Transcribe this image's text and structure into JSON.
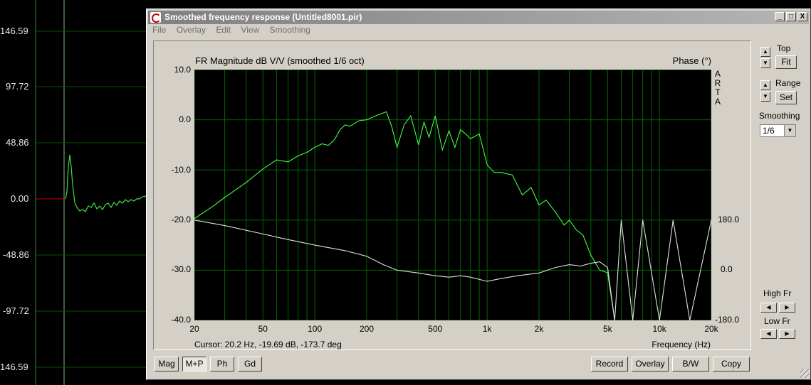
{
  "background_plot": {
    "y_labels": [
      "146.59",
      "97.72",
      "48.86",
      "0.00",
      "-48.86",
      "-97.72",
      "146.59"
    ],
    "colors": {
      "zero_line": "#d00000",
      "grid": "#80d080",
      "trace": "#40e040"
    }
  },
  "window": {
    "title": "Smoothed frequency response (Untitled8001.pir)",
    "controls": {
      "minimize": "_",
      "maximize": "□",
      "close": "X"
    }
  },
  "menu": [
    "File",
    "Overlay",
    "Edit",
    "View",
    "Smoothing"
  ],
  "plot": {
    "title": "FR Magnitude dB V/V (smoothed 1/6 oct)",
    "phase_title": "Phase (°)",
    "brand": [
      "A",
      "R",
      "T",
      "A"
    ],
    "cursor": "Cursor: 20.2 Hz, -19.69 dB, -173.7 deg",
    "x_axis_label": "Frequency (Hz)"
  },
  "chart_data": {
    "type": "line",
    "title": "FR Magnitude dB V/V (smoothed 1/6 oct)",
    "xlabel": "Frequency (Hz)",
    "ylabel": "",
    "y2label": "Phase (°)",
    "x_scale": "log",
    "xlim": [
      20,
      20000
    ],
    "ylim": [
      -40,
      10
    ],
    "y2lim": [
      -180,
      180
    ],
    "x_ticks": [
      "20",
      "50",
      "100",
      "200",
      "500",
      "1k",
      "2k",
      "5k",
      "10k",
      "20k"
    ],
    "y_ticks": [
      "10.0",
      "0.0",
      "-10.0",
      "-20.0",
      "-30.0",
      "-40.0"
    ],
    "y2_ticks": [
      "180.0",
      "0.0",
      "-180.0"
    ],
    "colors": {
      "magnitude": "#40ff40",
      "phase": "#e0e0e0",
      "grid": "#006600",
      "background": "#000000"
    },
    "series": [
      {
        "role": "magnitude",
        "x": [
          20,
          25,
          30,
          40,
          50,
          60,
          70,
          80,
          90,
          100,
          110,
          120,
          130,
          140,
          150,
          160,
          180,
          200,
          230,
          260,
          280,
          300,
          330,
          360,
          400,
          430,
          460,
          500,
          550,
          600,
          650,
          700,
          750,
          800,
          900,
          1000,
          1100,
          1200,
          1400,
          1600,
          1800,
          2000,
          2200,
          2500,
          2800,
          3000,
          3300,
          3600,
          4000,
          4500,
          5000,
          5500
        ],
        "y": [
          -19.7,
          -17.5,
          -15.5,
          -12.5,
          -9.8,
          -8.0,
          -8.4,
          -7.2,
          -6.5,
          -5.5,
          -4.8,
          -5.1,
          -4.0,
          -2.0,
          -1.0,
          -1.3,
          -0.2,
          0.0,
          0.9,
          1.6,
          -1.5,
          -5.5,
          -1.0,
          0.8,
          -5.0,
          -0.5,
          -3.5,
          0.8,
          -6.0,
          -2.2,
          -5.5,
          -2.0,
          -2.8,
          -3.8,
          -2.8,
          -9.0,
          -10.5,
          -10.5,
          -11.0,
          -15.0,
          -13.5,
          -17.0,
          -16.0,
          -18.5,
          -21.0,
          -20.0,
          -22.0,
          -23.0,
          -27.0,
          -30.0,
          -30.5,
          -40.0
        ]
      },
      {
        "role": "phase",
        "x": [
          20,
          30,
          50,
          70,
          100,
          150,
          200,
          250,
          300,
          400,
          500,
          600,
          700,
          800,
          1000,
          1200,
          1500,
          2000,
          2500,
          3000,
          3500,
          4000,
          4500,
          5000,
          5500,
          6000,
          7000,
          8000,
          10000,
          12000,
          15000,
          20000
        ],
        "y": [
          180,
          160,
          130,
          110,
          90,
          70,
          50,
          20,
          0,
          -10,
          -20,
          -25,
          -20,
          -25,
          -40,
          -30,
          -20,
          -10,
          10,
          20,
          15,
          25,
          30,
          10,
          -180,
          180,
          -180,
          180,
          -180,
          180,
          -180,
          180
        ]
      }
    ]
  },
  "bottom_buttons": {
    "mag": "Mag",
    "mp": "M+P",
    "ph": "Ph",
    "gd": "Gd",
    "record": "Record",
    "overlay": "Overlay",
    "bw": "B/W",
    "copy": "Copy"
  },
  "side": {
    "top_label": "Top",
    "fit": "Fit",
    "range_label": "Range",
    "set": "Set",
    "smoothing_label": "Smoothing",
    "smoothing_value": "1/6",
    "high_fr": "High Fr",
    "low_fr": "Low Fr"
  }
}
